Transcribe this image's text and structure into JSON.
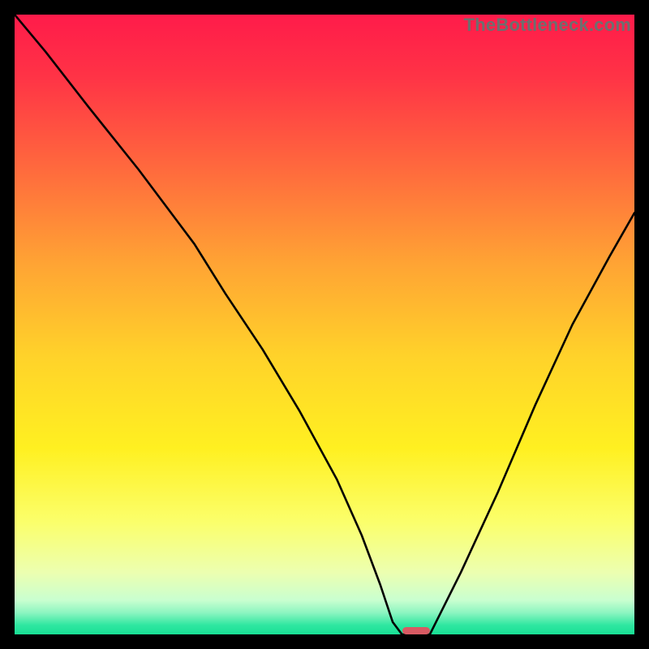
{
  "watermark": "TheBottleneck.com",
  "colors": {
    "bg": "#000000",
    "curve": "#000000",
    "marker": "#d85a63",
    "watermark": "#6e6e6e"
  },
  "chart_data": {
    "type": "line",
    "title": "",
    "xlabel": "",
    "ylabel": "",
    "xlim": [
      0,
      100
    ],
    "ylim": [
      0,
      100
    ],
    "grid": false,
    "legend": false,
    "gradient_stops": [
      {
        "offset": 0.0,
        "color": "#ff1b4a"
      },
      {
        "offset": 0.1,
        "color": "#ff3346"
      },
      {
        "offset": 0.25,
        "color": "#ff6a3d"
      },
      {
        "offset": 0.4,
        "color": "#ffa334"
      },
      {
        "offset": 0.55,
        "color": "#ffd22a"
      },
      {
        "offset": 0.7,
        "color": "#fff021"
      },
      {
        "offset": 0.82,
        "color": "#fbff6c"
      },
      {
        "offset": 0.9,
        "color": "#ecffb0"
      },
      {
        "offset": 0.945,
        "color": "#c9ffd0"
      },
      {
        "offset": 0.965,
        "color": "#8cf5c0"
      },
      {
        "offset": 0.985,
        "color": "#2fe7a1"
      },
      {
        "offset": 1.0,
        "color": "#18df94"
      }
    ],
    "series": [
      {
        "name": "bottleneck-curve",
        "x": [
          0,
          5,
          12,
          20,
          26,
          29,
          34,
          40,
          46,
          52,
          56,
          59,
          61,
          62.5,
          64,
          67,
          68,
          72,
          78,
          84,
          90,
          96,
          100
        ],
        "y": [
          100,
          94,
          85,
          75,
          67,
          63,
          55,
          46,
          36,
          25,
          16,
          8,
          2,
          0,
          0,
          0,
          2,
          10,
          23,
          37,
          50,
          61,
          68
        ]
      }
    ],
    "marker": {
      "x_start": 62.5,
      "x_end": 67,
      "y": 0,
      "height_pct": 1.2
    }
  }
}
